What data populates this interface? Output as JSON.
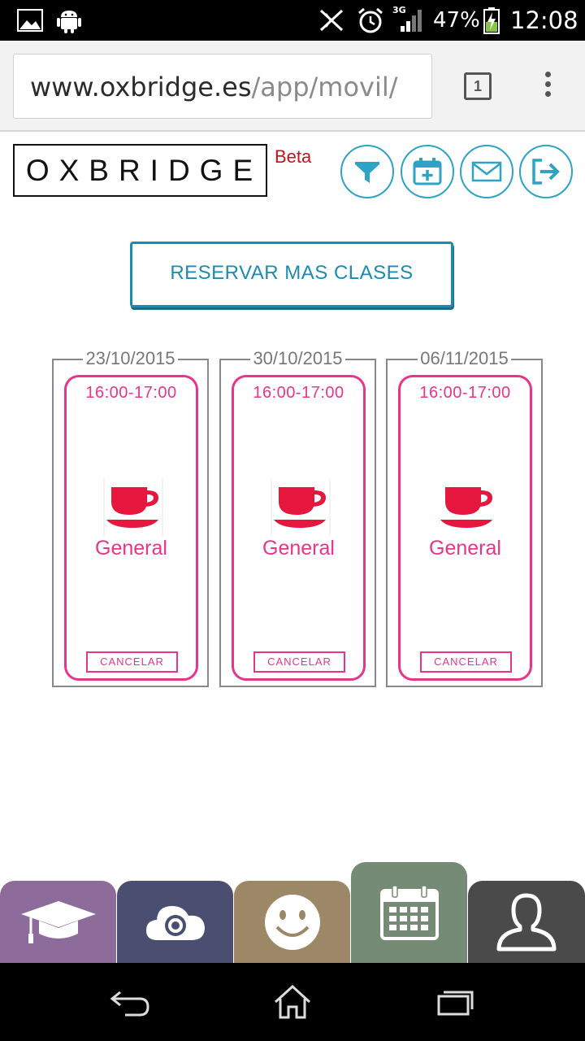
{
  "status_bar": {
    "network": "3G",
    "battery": "47%",
    "time": "12:08"
  },
  "browser": {
    "url_domain": "www.oxbridge.es",
    "url_path": "/app/movil/",
    "tab_count": "1"
  },
  "header": {
    "logo": "OXBRIDGE",
    "beta": "Beta",
    "icons": [
      "filter-icon",
      "calendar-add-icon",
      "mail-icon",
      "logout-icon"
    ]
  },
  "reserve_button": "RESERVAR MAS CLASES",
  "sessions": [
    {
      "date": "23/10/2015",
      "time": "16:00-17:00",
      "label": "General",
      "cancel": "CANCELAR"
    },
    {
      "date": "30/10/2015",
      "time": "16:00-17:00",
      "label": "General",
      "cancel": "CANCELAR"
    },
    {
      "date": "06/11/2015",
      "time": "16:00-17:00",
      "label": "General",
      "cancel": "CANCELAR"
    }
  ],
  "bottom_tabs": [
    {
      "icon": "graduation-cap-icon",
      "color": "#8d6b9b"
    },
    {
      "icon": "cloud-camera-icon",
      "color": "#4a4f72"
    },
    {
      "icon": "smiley-icon",
      "color": "#9c8866"
    },
    {
      "icon": "calendar-icon",
      "color": "#768b75",
      "active": true
    },
    {
      "icon": "user-icon",
      "color": "#4a4a4a"
    }
  ],
  "colors": {
    "accent_blue": "#2ea3c3",
    "accent_pink": "#e8358a",
    "cup_red": "#e5173f",
    "beta_red": "#c0141e"
  }
}
